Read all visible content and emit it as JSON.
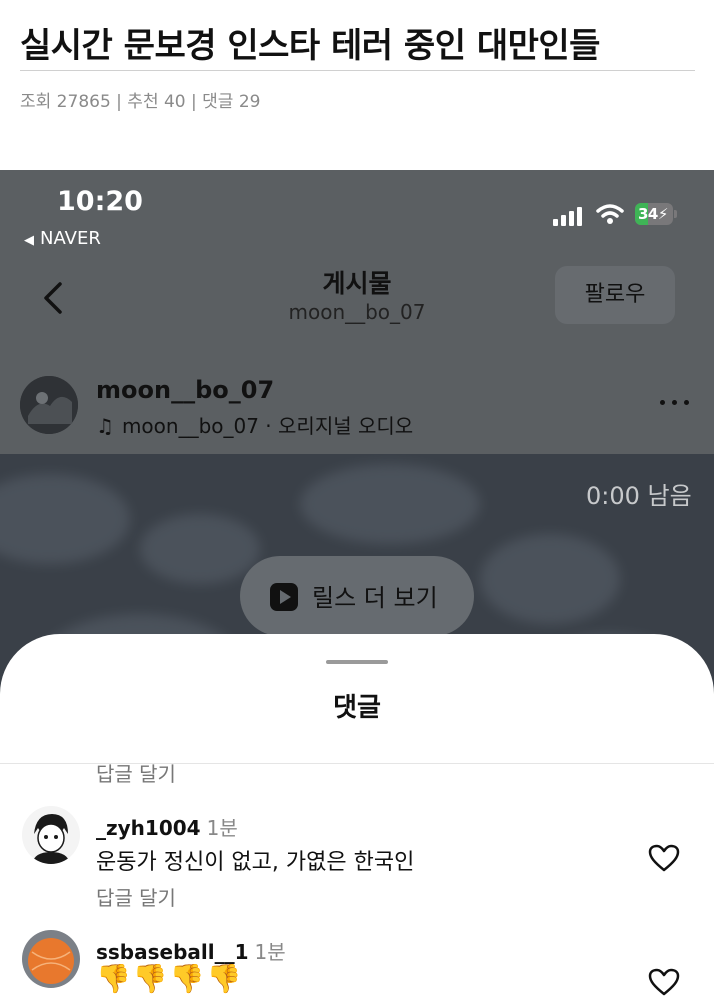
{
  "article": {
    "title": "실시간 문보경 인스타 테러 중인 대만인들",
    "meta": "조회 27865 | 추천 40 | 댓글 29"
  },
  "status_bar": {
    "time": "10:20",
    "back_app": "NAVER",
    "battery": "34",
    "battery_level": 0.34
  },
  "nav": {
    "title": "게시물",
    "subtitle": "moon__bo_07",
    "follow_label": "팔로우"
  },
  "post": {
    "username": "moon__bo_07",
    "audio": "moon__bo_07 · 오리지널 오디오"
  },
  "video": {
    "remaining": "0:00 남음",
    "reels_label": "릴스 더 보기"
  },
  "comments_sheet": {
    "title": "댓글",
    "top_reply_label": "답글 달기",
    "comments": [
      {
        "username": "_zyh1004",
        "time": "1분",
        "text": "운동가 정신이 없고, 가엾은 한국인",
        "reply_label": "답글 달기"
      },
      {
        "username": "ssbaseball__1",
        "time": "1분",
        "text": "👎👎👎👎"
      }
    ]
  },
  "colors": {
    "overlay": "#5b5f62",
    "battery_green": "#3fb456",
    "heart_stroke": "#111111"
  },
  "icons": [
    "back-chevron-icon",
    "more-dots-icon",
    "music-note-icon",
    "play-icon",
    "heart-icon",
    "wifi-icon",
    "signal-icon",
    "battery-icon"
  ]
}
